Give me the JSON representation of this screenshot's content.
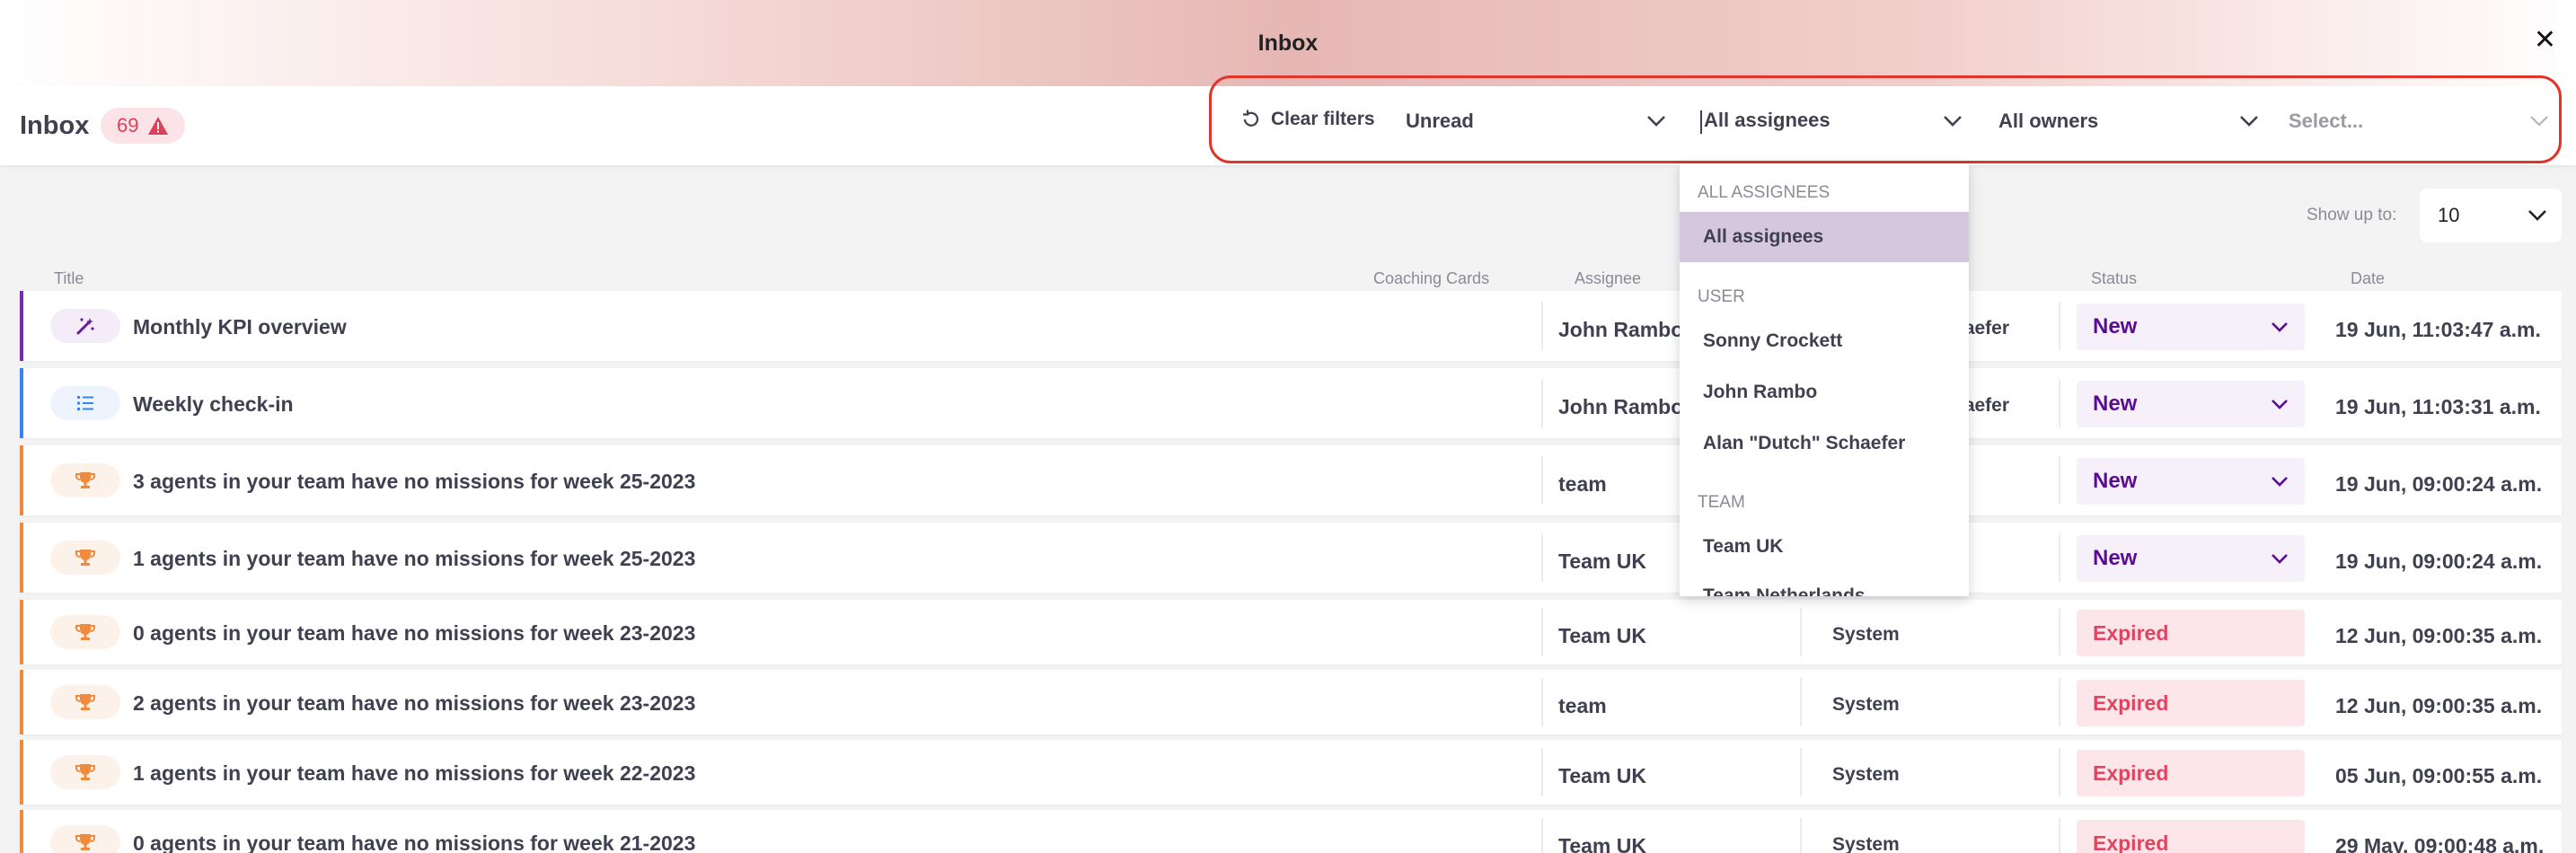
{
  "window": {
    "title": "Inbox",
    "close_icon": "close-icon"
  },
  "toolbar": {
    "inbox_label": "Inbox",
    "badge_count": "69",
    "clear_filters": "Clear filters",
    "read_filter": "Unread",
    "assignee_filter": "All assignees",
    "owner_filter": "All owners",
    "extra_filter_placeholder": "Select..."
  },
  "show_up_to": {
    "label": "Show up to:",
    "value": "10"
  },
  "columns": {
    "title": "Title",
    "coaching_cards": "Coaching Cards",
    "assignee": "Assignee",
    "status": "Status",
    "date": "Date"
  },
  "rows": [
    {
      "icon": "magic-wand-icon",
      "title": "Monthly KPI overview",
      "assignee": "John Rambo",
      "owner": "haefer",
      "status": "New",
      "date": "19 Jun, 11:03:47 a.m."
    },
    {
      "icon": "checklist-icon",
      "title": "Weekly check-in",
      "assignee": "John Rambo",
      "owner": "haefer",
      "status": "New",
      "date": "19 Jun, 11:03:31 a.m."
    },
    {
      "icon": "trophy-icon",
      "title": "3 agents in your team have no missions for week 25-2023",
      "assignee": "team",
      "owner": "",
      "status": "New",
      "date": "19 Jun, 09:00:24 a.m."
    },
    {
      "icon": "trophy-icon",
      "title": "1 agents in your team have no missions for week 25-2023",
      "assignee": "Team UK",
      "owner": "",
      "status": "New",
      "date": "19 Jun, 09:00:24 a.m."
    },
    {
      "icon": "trophy-icon",
      "title": "0 agents in your team have no missions for week 23-2023",
      "assignee": "Team UK",
      "owner": "System",
      "status": "Expired",
      "date": "12 Jun, 09:00:35 a.m."
    },
    {
      "icon": "trophy-icon",
      "title": "2 agents in your team have no missions for week 23-2023",
      "assignee": "team",
      "owner": "System",
      "status": "Expired",
      "date": "12 Jun, 09:00:35 a.m."
    },
    {
      "icon": "trophy-icon",
      "title": "1 agents in your team have no missions for week 22-2023",
      "assignee": "Team UK",
      "owner": "System",
      "status": "Expired",
      "date": "05 Jun, 09:00:55 a.m."
    },
    {
      "icon": "trophy-icon",
      "title": "0 agents in your team have no missions for week 21-2023",
      "assignee": "Team UK",
      "owner": "System",
      "status": "Expired",
      "date": "29 May, 09:00:48 a.m."
    }
  ],
  "assignee_dropdown": {
    "group_all": "All assignees",
    "option_all": "All assignees",
    "group_user": "User",
    "users": [
      "Sonny Crockett",
      "John Rambo",
      "Alan \"Dutch\" Schaefer"
    ],
    "group_team": "Team",
    "teams": [
      "Team UK",
      "Team Netherlands"
    ]
  },
  "colors": {
    "accent_purple": "#5b0d91",
    "expired_red": "#e0445e",
    "highlight_border": "#e0352b",
    "row_orange": "#f08a3c",
    "row_purple": "#7a2aa6",
    "row_blue": "#3b82f6"
  }
}
